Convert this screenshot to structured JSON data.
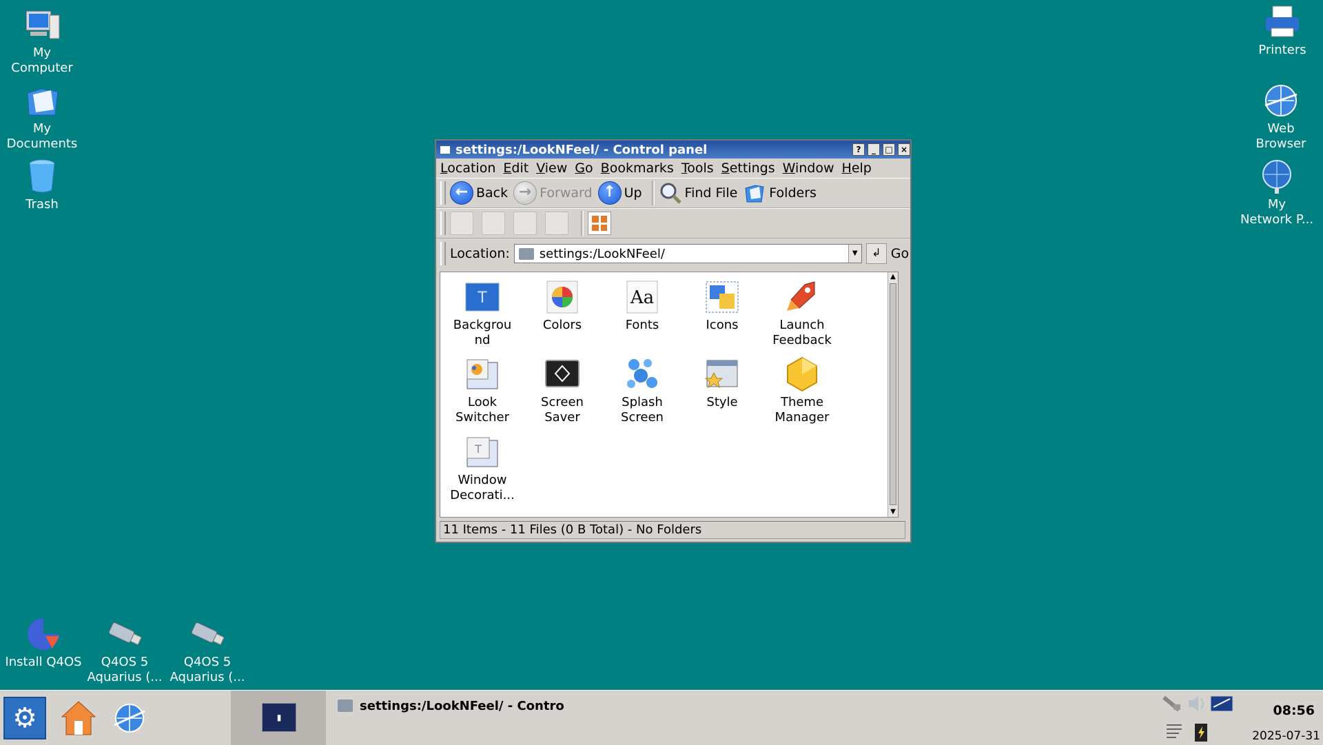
{
  "desktop": {
    "left_icons": [
      {
        "label": "My\nComputer",
        "icon": "computer-icon"
      },
      {
        "label": "My\nDocuments",
        "icon": "documents-icon"
      },
      {
        "label": "Trash",
        "icon": "trash-icon"
      }
    ],
    "right_icons": [
      {
        "label": "Printers",
        "icon": "printer-icon"
      },
      {
        "label": "Web\nBrowser",
        "icon": "web-browser-icon"
      },
      {
        "label": "My\nNetwork P...",
        "icon": "network-icon"
      }
    ],
    "bottom_icons": [
      {
        "label": "Install Q4OS",
        "icon": "install-icon"
      },
      {
        "label": "Q4OS 5\nAquarius (...",
        "icon": "usb-drive-icon"
      },
      {
        "label": "Q4OS 5\nAquarius (...",
        "icon": "usb-drive-icon"
      }
    ]
  },
  "window": {
    "title": "settings:/LookNFeel/ - Control panel",
    "menu": [
      "Location",
      "Edit",
      "View",
      "Go",
      "Bookmarks",
      "Tools",
      "Settings",
      "Window",
      "Help"
    ],
    "toolbar": {
      "back": "Back",
      "forward": "Forward",
      "up": "Up",
      "find_file": "Find File",
      "folders": "Folders"
    },
    "location": {
      "label": "Location:",
      "value": "settings:/LookNFeel/",
      "go": "Go"
    },
    "items": [
      {
        "label": "Backgrou\nnd",
        "icon": "background-icon"
      },
      {
        "label": "Colors",
        "icon": "colors-icon"
      },
      {
        "label": "Fonts",
        "icon": "fonts-icon"
      },
      {
        "label": "Icons",
        "icon": "icons-icon"
      },
      {
        "label": "Launch\nFeedback",
        "icon": "launch-feedback-icon"
      },
      {
        "label": "Look\nSwitcher",
        "icon": "look-switcher-icon"
      },
      {
        "label": "Screen\nSaver",
        "icon": "screen-saver-icon"
      },
      {
        "label": "Splash\nScreen",
        "icon": "splash-screen-icon"
      },
      {
        "label": "Style",
        "icon": "style-icon"
      },
      {
        "label": "Theme\nManager",
        "icon": "theme-manager-icon"
      },
      {
        "label": "Window\nDecorati...",
        "icon": "window-decorations-icon"
      }
    ],
    "status": "11 Items - 11 Files (0 B Total) - No Folders"
  },
  "taskbar": {
    "task_title": "settings:/LookNFeel/ - Contro",
    "clock": "08:56",
    "date": "2025-07-31"
  },
  "colors": {
    "desktop": "#008080",
    "titlebar": "#234f9f",
    "window_bg": "#d6d3ce"
  }
}
